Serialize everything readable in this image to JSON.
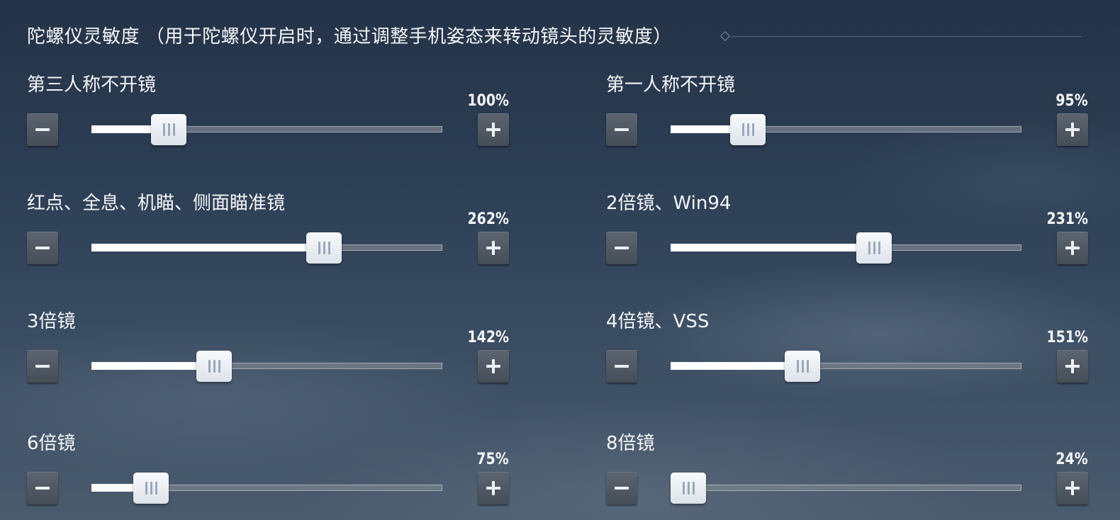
{
  "header": {
    "title": "陀螺仪灵敏度 （用于陀螺仪开启时，通过调整手机姿态来转动镜头的灵敏度）"
  },
  "settings": [
    {
      "label": "第三人称不开镜",
      "value_text": "100%",
      "level": 0.22
    },
    {
      "label": "第一人称不开镜",
      "value_text": "95%",
      "level": 0.22
    },
    {
      "label": "红点、全息、机瞄、侧面瞄准镜",
      "value_text": "262%",
      "level": 0.663
    },
    {
      "label": "2倍镜、Win94",
      "value_text": "231%",
      "level": 0.579
    },
    {
      "label": "3倍镜",
      "value_text": "142%",
      "level": 0.35
    },
    {
      "label": "4倍镜、VSS",
      "value_text": "151%",
      "level": 0.375
    },
    {
      "label": "6倍镜",
      "value_text": "75%",
      "level": 0.17
    },
    {
      "label": "8倍镜",
      "value_text": "24%",
      "level": 0.05
    }
  ]
}
